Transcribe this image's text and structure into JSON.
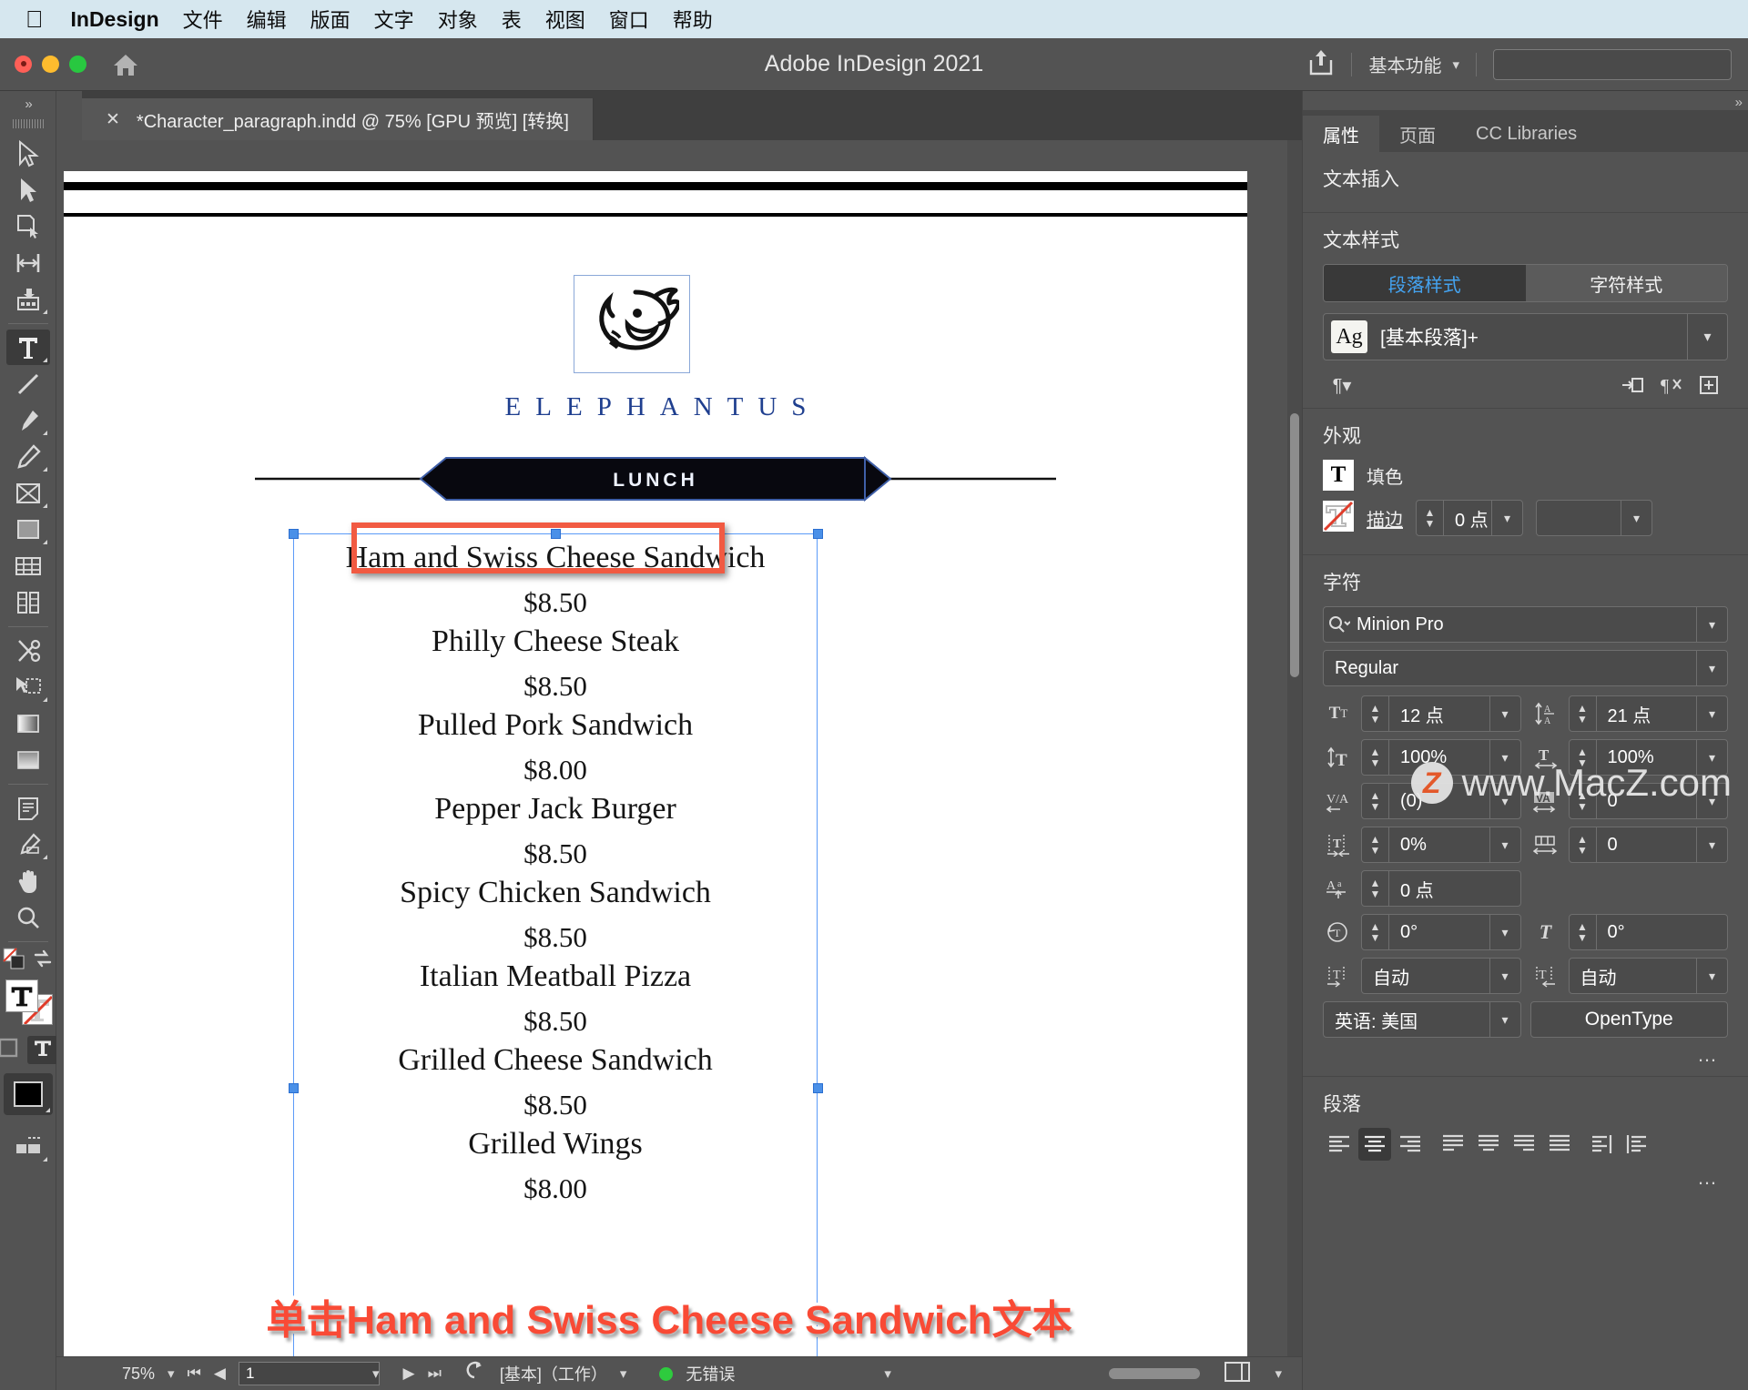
{
  "macbar": {
    "apple_icon": "apple-icon",
    "app_name": "InDesign",
    "menus": [
      "文件",
      "编辑",
      "版面",
      "文字",
      "对象",
      "表",
      "视图",
      "窗口",
      "帮助"
    ]
  },
  "titlebar": {
    "title": "Adobe InDesign 2021",
    "home_icon": "home-icon",
    "share_icon": "share-icon",
    "workspace": "基本功能",
    "search_placeholder": ""
  },
  "tabs": {
    "close_icon": "close-icon",
    "document_tab": "*Character_paragraph.indd @ 75% [GPU 预览] [转换]"
  },
  "tools": [
    {
      "name": "selection-tool",
      "glyph": "selection"
    },
    {
      "name": "direct-selection-tool",
      "glyph": "direct"
    },
    {
      "name": "page-tool",
      "glyph": "page"
    },
    {
      "name": "gap-tool",
      "glyph": "gap"
    },
    {
      "name": "content-collector-tool",
      "glyph": "collector"
    },
    {
      "name": "type-tool",
      "glyph": "type",
      "selected": true
    },
    {
      "name": "line-tool",
      "glyph": "line"
    },
    {
      "name": "pen-tool",
      "glyph": "pen"
    },
    {
      "name": "pencil-tool",
      "glyph": "pencil"
    },
    {
      "name": "frame-tool",
      "glyph": "frame"
    },
    {
      "name": "rectangle-tool",
      "glyph": "rect"
    },
    {
      "name": "table-tool",
      "glyph": "table"
    },
    {
      "name": "column-tool",
      "glyph": "columns"
    },
    {
      "name": "scissors-tool",
      "glyph": "scissors"
    },
    {
      "name": "free-transform-tool",
      "glyph": "transform"
    },
    {
      "name": "gradient-tool",
      "glyph": "gradient"
    },
    {
      "name": "gradient-feather-tool",
      "glyph": "feather"
    },
    {
      "name": "note-tool",
      "glyph": "note"
    },
    {
      "name": "eyedropper-tool",
      "glyph": "eyedropper"
    },
    {
      "name": "hand-tool",
      "glyph": "hand"
    },
    {
      "name": "zoom-tool",
      "glyph": "zoom"
    }
  ],
  "document": {
    "brand": "ELEPHANTUS",
    "banner_label": "LUNCH",
    "logo_icon": "fish-logo-icon",
    "menu_items": [
      {
        "name": "Ham and Swiss Cheese Sandwich",
        "price": "$8.50"
      },
      {
        "name": "Philly Cheese Steak",
        "price": "$8.50"
      },
      {
        "name": "Pulled Pork Sandwich",
        "price": "$8.00"
      },
      {
        "name": "Pepper Jack Burger",
        "price": "$8.50"
      },
      {
        "name": "Spicy Chicken Sandwich",
        "price": "$8.50"
      },
      {
        "name": "Italian Meatball Pizza",
        "price": "$8.50"
      },
      {
        "name": "Grilled Cheese Sandwich",
        "price": "$8.50"
      },
      {
        "name": "Grilled Wings",
        "price": "$8.00"
      }
    ],
    "annotation": "单击Ham and Swiss Cheese Sandwich文本",
    "highlight_color": "#f15a42"
  },
  "statusbar": {
    "zoom": "75%",
    "page": "1",
    "page_icons": [
      "first-page-icon",
      "prev-page-icon",
      "next-page-icon",
      "last-page-icon"
    ],
    "master": "[基本]（工作）",
    "errors": "无错误",
    "error_color": "#2ecb3e"
  },
  "properties": {
    "tabs": [
      {
        "label": "属性",
        "active": true
      },
      {
        "label": "页面",
        "active": false
      },
      {
        "label": "CC Libraries",
        "active": false
      }
    ],
    "text_insert_title": "文本插入",
    "text_style": {
      "title": "文本样式",
      "segments": [
        {
          "label": "段落样式",
          "active": true
        },
        {
          "label": "字符样式",
          "active": false
        }
      ],
      "style_preview": "Ag",
      "style_name": "[基本段落]+",
      "icons": [
        "paragraph-style-icon",
        "redefine-style-icon",
        "clear-overrides-icon",
        "new-style-icon"
      ]
    },
    "appearance": {
      "title": "外观",
      "fill_label": "填色",
      "stroke_label": "描边",
      "stroke_weight": "0 点",
      "fill_icon": "fill-swatch-icon",
      "stroke_icon": "stroke-none-icon"
    },
    "character": {
      "title": "字符",
      "font_family": "Minion Pro",
      "font_style": "Regular",
      "font_size": "12 点",
      "leading": "21 点",
      "vertical_scale": "100%",
      "horizontal_scale": "100%",
      "kerning": "(0)",
      "tracking": "0",
      "baseline_shift_pct": "0%",
      "grid_tracking": "0",
      "baseline_shift": "0 点",
      "rotation": "0°",
      "skew": "0°",
      "tsume_left": "自动",
      "tsume_right": "自动",
      "language": "英语: 美国",
      "opentype": "OpenType",
      "search_icon": "font-search-icon",
      "field_icons": [
        "font-size-icon",
        "leading-icon",
        "vertical-scale-icon",
        "horizontal-scale-icon",
        "kerning-icon",
        "tracking-icon",
        "baseline-pct-icon",
        "grid-tracking-icon",
        "baseline-shift-icon",
        "character-rotation-icon",
        "skew-icon",
        "tsume-left-icon",
        "tsume-right-icon"
      ]
    },
    "paragraph": {
      "title": "段落",
      "align_buttons": [
        {
          "name": "align-left",
          "active": false
        },
        {
          "name": "align-center",
          "active": true
        },
        {
          "name": "align-right",
          "active": false
        },
        {
          "name": "justify-last-left",
          "active": false
        },
        {
          "name": "justify-last-center",
          "active": false
        },
        {
          "name": "justify-last-right",
          "active": false
        },
        {
          "name": "justify-all",
          "active": false
        },
        {
          "name": "align-toward-spine",
          "active": false
        },
        {
          "name": "align-away-spine",
          "active": false
        }
      ]
    },
    "more_options": "…"
  },
  "watermark": {
    "badge": "Z",
    "text": "www.MacZ.com"
  }
}
